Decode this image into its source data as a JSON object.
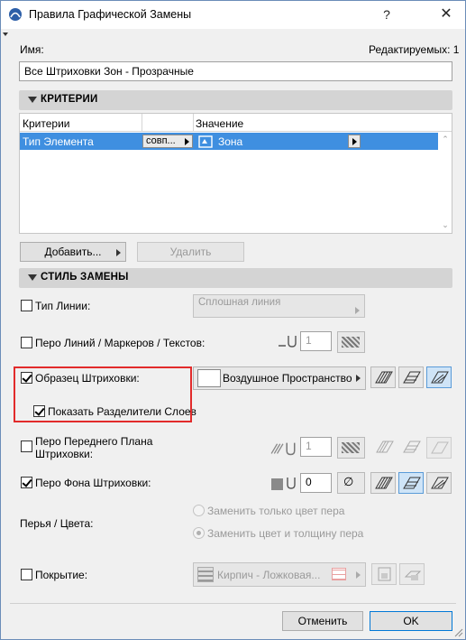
{
  "window": {
    "title": "Правила Графической Замены",
    "help": "?",
    "close": "✕"
  },
  "name_label": "Имя:",
  "editable_label": "Редактируемых: 1",
  "name_value": "Все Штриховки Зон - Прозрачные",
  "criteria": {
    "header": "КРИТЕРИИ",
    "col_criteria": "Критерии",
    "col_value": "Значение",
    "rows": [
      {
        "criterion": "Тип Элемента",
        "operator": "совп...",
        "value": "Зона"
      }
    ],
    "add_button": "Добавить...",
    "remove_button": "Удалить"
  },
  "style": {
    "header": "СТИЛЬ ЗАМЕНЫ",
    "line_type": {
      "label": "Тип Линии:",
      "checked": false,
      "value": "Сплошная линия"
    },
    "line_pen": {
      "label": "Перо Линий / Маркеров / Текстов:",
      "checked": false,
      "value": "1"
    },
    "fill_pattern": {
      "label": "Образец Штриховки:",
      "checked": true,
      "value": "Воздушное Пространство"
    },
    "show_separators": {
      "label": "Показать Разделители Слоев",
      "checked": true
    },
    "foreground_pen": {
      "label_line1": "Перо Переднего Плана",
      "label_line2": "Штриховки:",
      "checked": false,
      "value": "1"
    },
    "background_pen": {
      "label": "Перо Фона Штриховки:",
      "checked": true,
      "value": "0"
    },
    "pens_colors": {
      "label": "Перья / Цвета:",
      "option1": "Заменить только цвет пера",
      "option2": "Заменить цвет и толщину пера",
      "selected": "option2"
    },
    "surface": {
      "label": "Покрытие:",
      "checked": false,
      "value": "Кирпич - Ложковая..."
    }
  },
  "footer": {
    "cancel": "Отменить",
    "ok": "OK"
  },
  "colors": {
    "selection": "#3f8fe0",
    "highlight_border": "#e22b2b",
    "active_icon": "#cfe4f7"
  }
}
